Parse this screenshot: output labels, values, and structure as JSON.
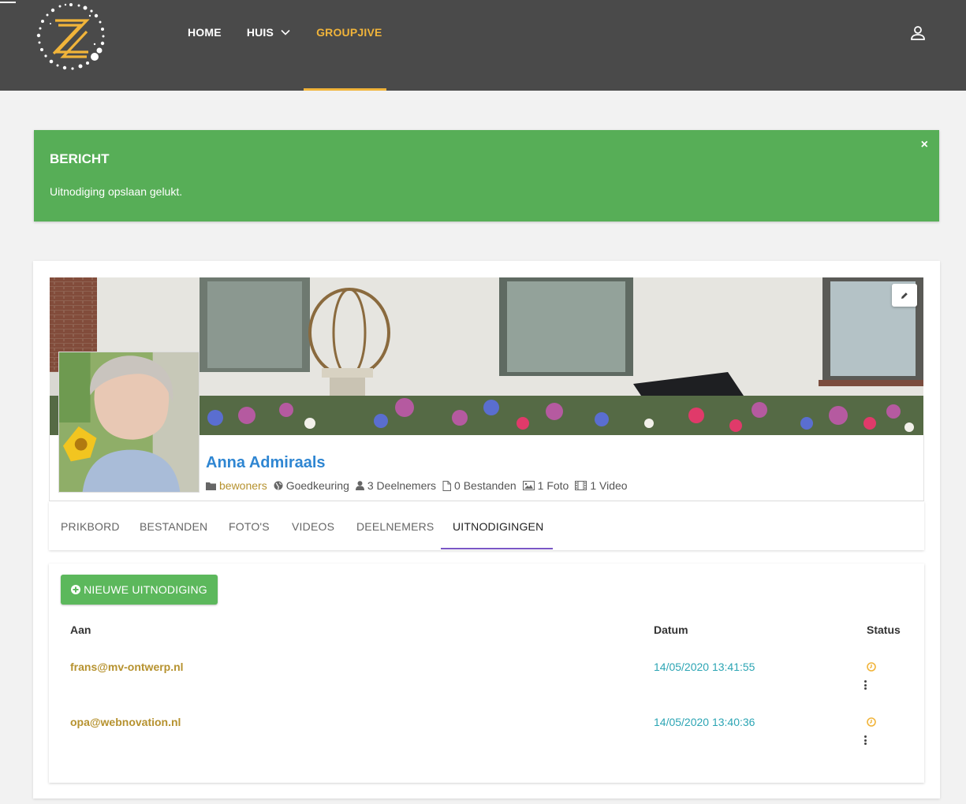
{
  "nav": {
    "items": [
      {
        "label": "HOME"
      },
      {
        "label": "HUIS"
      },
      {
        "label": "GROUPJIVE"
      }
    ]
  },
  "alert": {
    "title": "BERICHT",
    "text": "Uitnodiging opslaan gelukt.",
    "close": "×"
  },
  "profile": {
    "name": "Anna Admiraals",
    "category": "bewoners",
    "approval": "Goedkeuring",
    "members": "3 Deelnemers",
    "files": "0 Bestanden",
    "photos": "1 Foto",
    "videos": "1 Video"
  },
  "tabs": [
    {
      "label": "PRIKBORD"
    },
    {
      "label": "BESTANDEN"
    },
    {
      "label": "FOTO'S"
    },
    {
      "label": "VIDEOS"
    },
    {
      "label": "DEELNEMERS"
    },
    {
      "label": "UITNODIGINGEN"
    }
  ],
  "invitations": {
    "new_button": "NIEUWE UITNODIGING",
    "columns": {
      "to": "Aan",
      "date": "Datum",
      "status": "Status"
    },
    "rows": [
      {
        "email": "frans@mv-ontwerp.nl",
        "date": "14/05/2020 13:41:55",
        "status_icon": "clock-icon"
      },
      {
        "email": "opa@webnovation.nl",
        "date": "14/05/2020 13:40:36",
        "status_icon": "clock-icon"
      }
    ]
  },
  "colors": {
    "topbar": "#4a4a4a",
    "accent": "#f1b43a",
    "alert_success": "#57ae57",
    "link_gold": "#b6922f",
    "name_blue": "#2f86d2",
    "date_teal": "#2ca5b4",
    "tab_underline": "#7b57c6",
    "button_green": "#5cb85c"
  }
}
